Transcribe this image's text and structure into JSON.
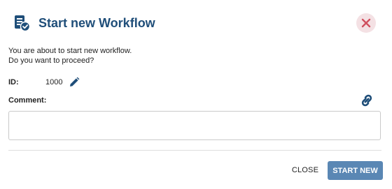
{
  "dialog": {
    "title": "Start new Workflow",
    "header_icon": "workflow-check-icon",
    "close_icon": "close-icon",
    "message_line1": "You are about to start new workflow.",
    "message_line2": "Do you want to proceed?",
    "id_label": "ID:",
    "id_value": "1000",
    "edit_icon": "pencil-icon",
    "comment_label": "Comment:",
    "comment_value": "",
    "link_icon": "link-icon",
    "close_button": "CLOSE",
    "start_button": "START NEW"
  },
  "colors": {
    "title": "#1f4e79",
    "icon": "#1f4e79",
    "close_bg": "#f4e1e4",
    "close_x": "#d0505f",
    "primary_button": "#5a87b4"
  }
}
